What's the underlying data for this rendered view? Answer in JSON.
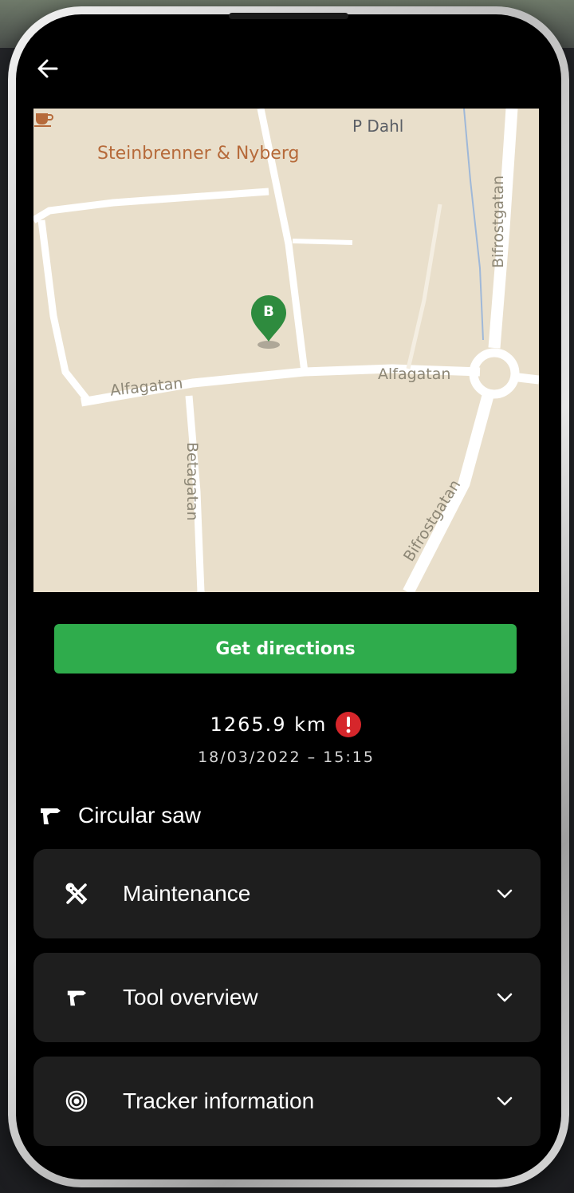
{
  "map": {
    "poi_label": "Steinbrenner & Nyberg",
    "place_label": "P Dahl",
    "streets": {
      "alfagatan_west": "Alfagatan",
      "alfagatan_east": "Alfagatan",
      "betagatan": "Betagatan",
      "bifrostgatan_north": "Bifrostgatan",
      "bifrostgatan_south": "Bifrostgatan"
    },
    "marker_letter": "B",
    "colors": {
      "poi": "#b66a3a",
      "marker": "#2e8b3e",
      "land": "#e9dfcb",
      "road": "#ffffff"
    }
  },
  "actions": {
    "directions_label": "Get directions"
  },
  "status": {
    "distance": "1265.9 km",
    "timestamp": "18/03/2022 – 15:15",
    "alert_color": "#d6262b"
  },
  "tool": {
    "icon": "drill-icon",
    "name": "Circular saw"
  },
  "sections": [
    {
      "label": "Maintenance",
      "icon": "tools-icon"
    },
    {
      "label": "Tool overview",
      "icon": "drill-icon"
    },
    {
      "label": "Tracker information",
      "icon": "target-icon"
    }
  ],
  "theme": {
    "accent": "#2fac4c",
    "card_bg": "#1e1e1e",
    "screen_bg": "#000000"
  }
}
